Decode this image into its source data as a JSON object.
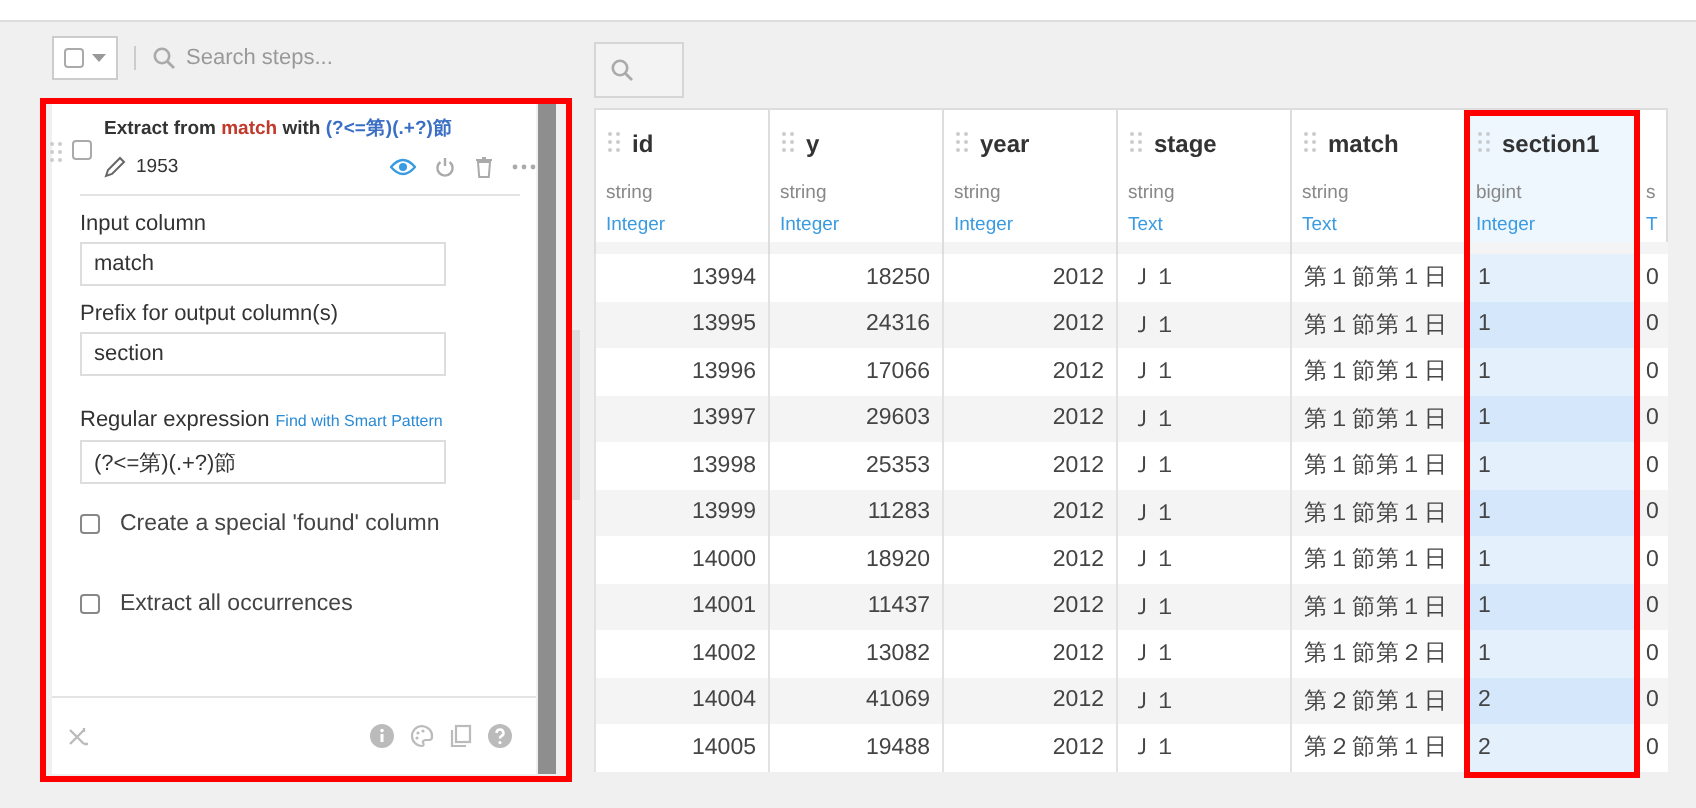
{
  "steps_toolbar": {
    "select_all": {
      "checked": false
    },
    "search": {
      "placeholder": "Search steps..."
    }
  },
  "step": {
    "checked": false,
    "visible": true,
    "title": [
      {
        "kind": "text",
        "text": "Extract from "
      },
      {
        "kind": "column",
        "text": "match"
      },
      {
        "kind": "text",
        "text": " with "
      },
      {
        "kind": "pattern",
        "text": "(?<=第)(.+?)節"
      }
    ],
    "comment": "1953",
    "fields": [
      {
        "label": "Input column",
        "value": "match"
      },
      {
        "label": "Prefix for output column(s)",
        "value": "section"
      },
      {
        "label": "Regular expression",
        "link": "Find with Smart Pattern",
        "value": "(?<=第)(.+?)節"
      }
    ],
    "options": [
      {
        "label": "Create a special 'found' column",
        "checked": false
      },
      {
        "label": "Extract all occurrences",
        "checked": false
      }
    ]
  },
  "table": {
    "columns": [
      {
        "name": "id",
        "storage": "string",
        "meaning": "Integer",
        "kind": "number",
        "selected": false
      },
      {
        "name": "y",
        "storage": "string",
        "meaning": "Integer",
        "kind": "number",
        "selected": false
      },
      {
        "name": "year",
        "storage": "string",
        "meaning": "Integer",
        "kind": "number",
        "selected": false
      },
      {
        "name": "stage",
        "storage": "string",
        "meaning": "Text",
        "kind": "text",
        "selected": false
      },
      {
        "name": "match",
        "storage": "string",
        "meaning": "Text",
        "kind": "text",
        "selected": false
      },
      {
        "name": "section1",
        "storage": "bigint",
        "meaning": "Integer",
        "kind": "text",
        "selected": true
      },
      {
        "storage": "s",
        "meaning": "T",
        "kind": "text",
        "selected": false
      }
    ],
    "rows": [
      [
        "13994",
        "18250",
        "2012",
        "Ｊ１",
        "第１節第１日",
        "1",
        "0"
      ],
      [
        "13995",
        "24316",
        "2012",
        "Ｊ１",
        "第１節第１日",
        "1",
        "0"
      ],
      [
        "13996",
        "17066",
        "2012",
        "Ｊ１",
        "第１節第１日",
        "1",
        "0"
      ],
      [
        "13997",
        "29603",
        "2012",
        "Ｊ１",
        "第１節第１日",
        "1",
        "0"
      ],
      [
        "13998",
        "25353",
        "2012",
        "Ｊ１",
        "第１節第１日",
        "1",
        "0"
      ],
      [
        "13999",
        "11283",
        "2012",
        "Ｊ１",
        "第１節第１日",
        "1",
        "0"
      ],
      [
        "14000",
        "18920",
        "2012",
        "Ｊ１",
        "第１節第１日",
        "1",
        "0"
      ],
      [
        "14001",
        "11437",
        "2012",
        "Ｊ１",
        "第１節第１日",
        "1",
        "0"
      ],
      [
        "14002",
        "13082",
        "2012",
        "Ｊ１",
        "第１節第２日",
        "1",
        "0"
      ],
      [
        "14004",
        "41069",
        "2012",
        "Ｊ１",
        "第２節第１日",
        "2",
        "0"
      ],
      [
        "14005",
        "19488",
        "2012",
        "Ｊ１",
        "第２節第１日",
        "2",
        "0"
      ]
    ]
  }
}
